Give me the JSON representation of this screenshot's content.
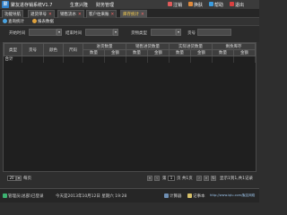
{
  "app": {
    "title": "聚友进存销系统V1.7",
    "logo_char": "聚"
  },
  "title_menu": {
    "ecommerce": "生意兴隆",
    "finance": "财务管理"
  },
  "title_actions": {
    "logout": "注销",
    "switch": "换肤",
    "help": "帮助",
    "exit": "退出"
  },
  "tabs": [
    {
      "label": "功能导航",
      "closable": false,
      "active": false
    },
    {
      "label": "退货单号",
      "closable": true,
      "active": false
    },
    {
      "label": "销售流水",
      "closable": true,
      "active": false
    },
    {
      "label": "客户往来账",
      "closable": true,
      "active": false
    },
    {
      "label": "库存统计",
      "closable": true,
      "active": true
    }
  ],
  "toolbar": {
    "query_label": "查询统计",
    "export_label": "报表数据"
  },
  "filter": {
    "start_date_label": "开始时间",
    "start_date_value": "",
    "end_date_label": "结束时间",
    "end_date_value": "",
    "goods_type_label": "货物类型",
    "goods_type_value": "",
    "goods_no_label": "货号",
    "goods_no_value": ""
  },
  "grid": {
    "headers_group": [
      "类型",
      "货号",
      "颜色",
      "尺码",
      "进货数量",
      "销售进货数量",
      "实际进货数量",
      "剩余库存"
    ],
    "sub_headers": [
      "数量",
      "金额",
      "数量",
      "金额",
      "数量",
      "金额",
      "数量",
      "金额"
    ],
    "total_label": "合计"
  },
  "pager": {
    "page_size": "20",
    "page_size_suffix": "每页",
    "page_text": "第",
    "page_value": "1",
    "page_of": "页 共1页",
    "range_text": "显示1到1,共1记录"
  },
  "status": {
    "user_label": "管理员",
    "shop_text": "(总部)已登录",
    "date_text": "今天是2013年10月12日 星期六 19:28",
    "calculator": "计算器",
    "notepad": "记事本",
    "website": "http://www.iqiu.com/聚友网络"
  },
  "colors": {
    "accent_blue": "#2f7fc9",
    "active_tab_text": "#ffd34d",
    "close_x": "#ff6b6b"
  }
}
